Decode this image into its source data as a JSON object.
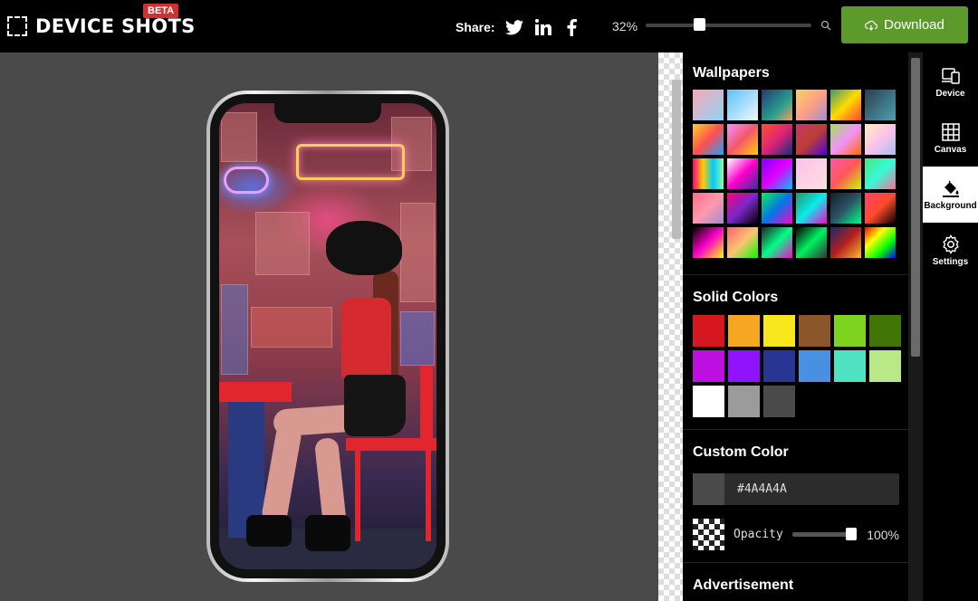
{
  "header": {
    "app_name": "DEVICE SHOTS",
    "beta_badge": "BETA",
    "share_label": "Share:",
    "share_icons": [
      "twitter-icon",
      "linkedin-icon",
      "facebook-icon"
    ],
    "zoom_percent": "32%",
    "zoom_value": 0.32,
    "download_label": "Download"
  },
  "canvas": {
    "background_color": "#4A4A4A"
  },
  "panel": {
    "wallpapers_title": "Wallpapers",
    "wallpapers": [
      "linear-gradient(135deg,#f7a8b8,#8fd3f4)",
      "linear-gradient(135deg,#5bc0f8,#f0f9ff)",
      "linear-gradient(135deg,#1e3c72,#2a9d8f 60%,#f4a261)",
      "linear-gradient(135deg,#f6d365,#fda085,#a18cd1)",
      "linear-gradient(135deg,#3d9970,#ffdc00,#ff4136)",
      "linear-gradient(135deg,#2c3e50,#4ca1af)",
      "linear-gradient(135deg,#f9d423,#ff4e50,#1fa2ff)",
      "linear-gradient(135deg,#f093fb,#f5576c,#ffd200)",
      "linear-gradient(135deg,#ff512f,#dd2476,#1a2980)",
      "linear-gradient(135deg,#cb356b,#bd3f32,#4a00e0)",
      "linear-gradient(135deg,#a8e063,#f093fb,#ff6a00)",
      "linear-gradient(135deg,#fff1b8,#fbc2eb,#a6c1ee)",
      "linear-gradient(90deg,#ff0084,#ffce00,#00c9ff,#92fe9d)",
      "linear-gradient(135deg,#fff,#ff00cc,#333399)",
      "linear-gradient(135deg,#7f00ff,#e100ff,#00c3ff)",
      "linear-gradient(135deg,#fbc2eb,#ffdde1)",
      "linear-gradient(135deg,#f857a6,#ff5858,#c0ff00)",
      "linear-gradient(135deg,#43e97b,#38f9d7,#fa709a)",
      "linear-gradient(135deg,#ff6a88,#ff99ac,#a18cd1)",
      "linear-gradient(135deg,#ff0080,#7928ca,#000)",
      "linear-gradient(135deg,#00f260,#0575e6,#ff00cc)",
      "linear-gradient(135deg,#1d976c,#0cebeb,#ff00cc)",
      "linear-gradient(135deg,#0f2027,#2c5364,#00ff87)",
      "linear-gradient(135deg,#ff416c,#ff4b2b,#000)",
      "linear-gradient(135deg,#000,#ff00cc,#ffff00)",
      "linear-gradient(135deg,#ff5f6d,#ffc371,#00ff00)",
      "linear-gradient(135deg,#222,#00ff87,#ff00cc)",
      "linear-gradient(135deg,#000,#00f260,#333)",
      "linear-gradient(135deg,#1a2a6c,#b21f1f,#fdbb2d)",
      "linear-gradient(135deg,#ff0000,#ffff00,#00ff00,#0000ff)"
    ],
    "solid_colors_title": "Solid Colors",
    "solid_colors": [
      "#d7171f",
      "#f5a623",
      "#f8e71c",
      "#8b572a",
      "#7ed321",
      "#417505",
      "#bd10e0",
      "#9013fe",
      "#283593",
      "#4a90e2",
      "#50e3c2",
      "#b8e986",
      "#ffffff",
      "#9b9b9b",
      "#4a4a4a"
    ],
    "custom_color_title": "Custom Color",
    "custom_color_value": "#4A4A4A",
    "opacity_label": "Opacity",
    "opacity_value": "100%",
    "opacity_level": 1.0,
    "advertisement_title": "Advertisement"
  },
  "nav": {
    "items": [
      {
        "label": "Device",
        "icon": "device-icon",
        "active": false
      },
      {
        "label": "Canvas",
        "icon": "grid-icon",
        "active": false
      },
      {
        "label": "Background",
        "icon": "paint-bucket-icon",
        "active": true
      },
      {
        "label": "Settings",
        "icon": "gear-icon",
        "active": false
      }
    ]
  }
}
